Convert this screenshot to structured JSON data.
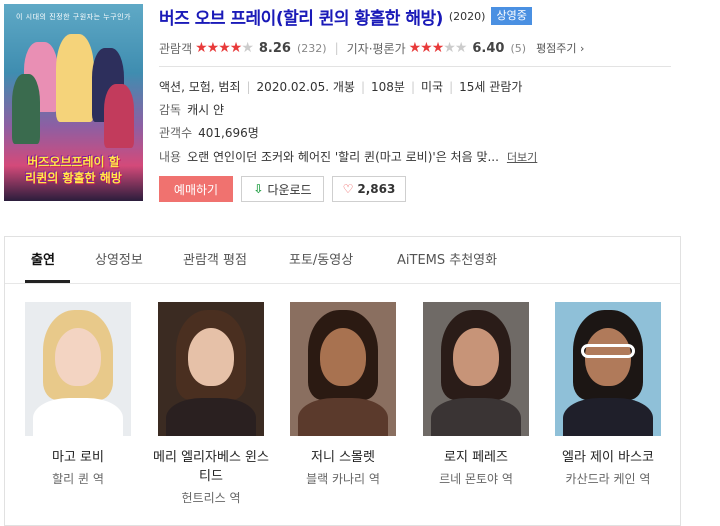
{
  "movie": {
    "title": "버즈 오브 프레이(할리 퀸의 황홀한 해방)",
    "year": "(2020)",
    "status_badge": "상영중",
    "poster_tagline": "이 시대의 진정한 구원자는 누구인가",
    "poster_title": "버즈오브프레이 할리퀸의 황홀한 해방",
    "audience_label": "관람객",
    "audience_stars": 4,
    "audience_score": "8.26",
    "audience_count": "(232)",
    "critic_label": "기자·평론가",
    "critic_stars": 3,
    "critic_score": "6.40",
    "critic_count": "(5)",
    "rate_link": "평점주기",
    "genre": "액션, 모험, 범죄",
    "release": "2020.02.05. 개봉",
    "runtime": "108분",
    "country": "미국",
    "rating": "15세 관람가",
    "director_label": "감독",
    "director": "캐시 얀",
    "audience_total_label": "관객수",
    "audience_total": "401,696명",
    "synopsis_label": "내용",
    "synopsis": "오랜 연인이던 조커와 헤어진 '할리 퀸(마고 로비)'은 처음 맞...",
    "more_label": "더보기"
  },
  "buttons": {
    "book": "예매하기",
    "download": "다운로드",
    "likes": "2,863"
  },
  "tabs": [
    "출연",
    "상영정보",
    "관람객 평점",
    "포토/동영상",
    "AiTEMS 추천영화"
  ],
  "cast": [
    {
      "name": "마고 로비",
      "role": "할리 퀸 역"
    },
    {
      "name": "메리 엘리자베스 윈스티드",
      "role": "헌트리스 역"
    },
    {
      "name": "저니 스몰렛",
      "role": "블랙 카나리 역"
    },
    {
      "name": "로지 페레즈",
      "role": "르네 몬토야 역"
    },
    {
      "name": "엘라 제이 바스코",
      "role": "카산드라 케인 역"
    }
  ],
  "colors": {
    "title": "#1a1ab8",
    "badge": "#4a90e2",
    "star": "#e83a3a",
    "book_button": "#f0726f"
  }
}
